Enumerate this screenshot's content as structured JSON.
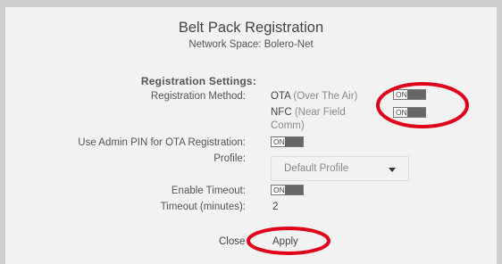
{
  "dialog": {
    "title": "Belt Pack Registration",
    "subtitle": "Network Space: Bolero-Net"
  },
  "registration_settings": {
    "heading": "Registration Settings:",
    "method_label": "Registration Method:",
    "ota_label": "OTA",
    "ota_desc": "(Over The Air)",
    "ota_toggle": "ON",
    "nfc_label": "NFC",
    "nfc_desc_line1": "(Near Field",
    "nfc_desc_line2": "Comm)",
    "nfc_toggle": "ON",
    "admin_pin_label": "Use Admin PIN for OTA Registration:",
    "admin_pin_toggle": "ON",
    "profile_label": "Profile:",
    "profile_value": "Default Profile",
    "timeout_label": "Enable Timeout:",
    "timeout_toggle": "ON",
    "timeout_minutes_label": "Timeout (minutes):",
    "timeout_minutes_value": "2"
  },
  "footer": {
    "close_label": "Close",
    "apply_label": "Apply"
  },
  "annotation_color": "#e0001a"
}
